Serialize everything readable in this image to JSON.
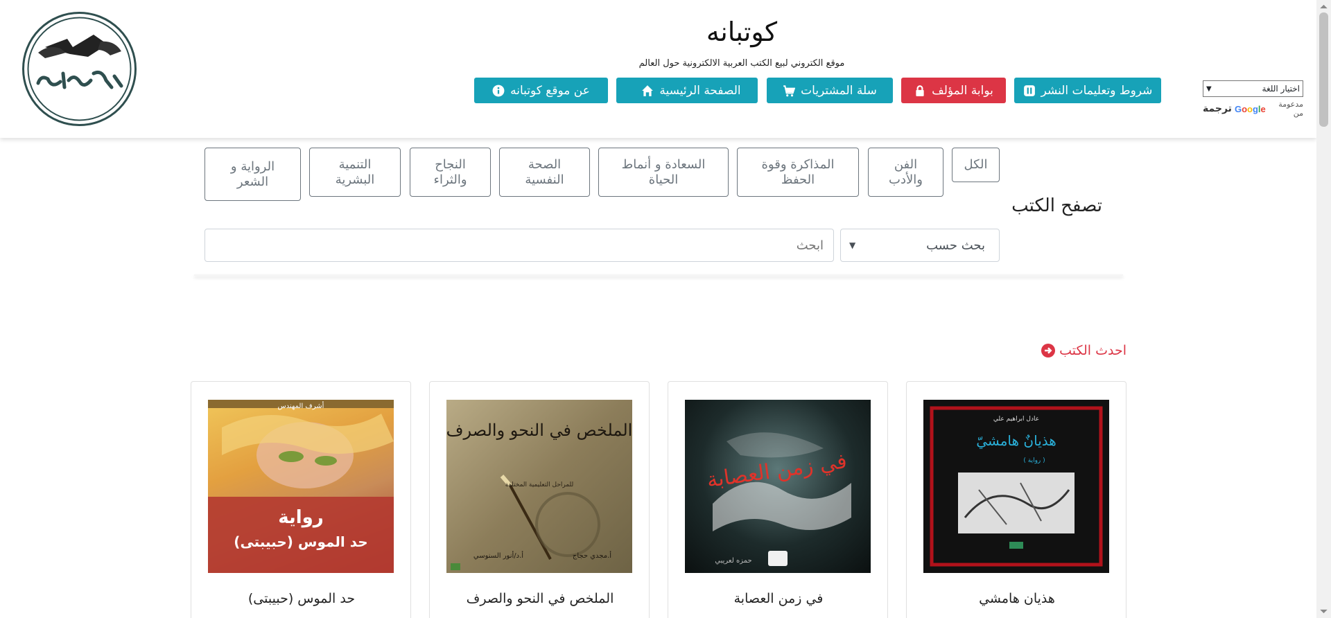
{
  "site": {
    "title": "كوتبانه",
    "subtitle": "موقع الكتروني لبيع الكتب العربية الالكترونية حول العالم"
  },
  "language": {
    "select_label": "اختيار اللغة",
    "powered_by": "مدعومة من",
    "google": "Google",
    "translate": "ترجمة"
  },
  "nav": [
    {
      "label": "شروط وتعليمات النشر",
      "icon": "pause-square-icon",
      "style": "teal"
    },
    {
      "label": "بوابة المؤلف",
      "icon": "lock-icon",
      "style": "red"
    },
    {
      "label": "سلة المشتريات",
      "icon": "cart-icon",
      "style": "teal"
    },
    {
      "label": "الصفحة الرئيسية",
      "icon": "home-icon",
      "style": "teal"
    },
    {
      "label": "عن موقع كوتبانه",
      "icon": "info-icon",
      "style": "teal"
    }
  ],
  "browse": {
    "title": "تصفح الكتب",
    "categories": [
      {
        "line1": "الكل",
        "line2": ""
      },
      {
        "line1": "الفن",
        "line2": "والأدب"
      },
      {
        "line1": "المذاكرة وقوة",
        "line2": "الحفظ"
      },
      {
        "line1": "السعادة و أنماط",
        "line2": "الحياة"
      },
      {
        "line1": "الصحة",
        "line2": "النفسية"
      },
      {
        "line1": "النجاح",
        "line2": "والثراء"
      },
      {
        "line1": "التنمية",
        "line2": "البشرية"
      },
      {
        "line1": "الرواية و",
        "line2": "الشعر"
      }
    ],
    "search_by": "بحث حسب",
    "search_placeholder": "ابحث"
  },
  "latest": {
    "label": "احدث الكتب",
    "books": [
      {
        "title": "هذيان هامشي",
        "cover_text": "هذيانٌ هامشيّ",
        "cover_author": "عادل ابراهيم علي",
        "cover_tag": "( رواية )"
      },
      {
        "title": "في زمن العصابة",
        "cover_text": "في زمن العصابة",
        "cover_author": "حمزه لعريبي"
      },
      {
        "title": "الملخص في النحو والصرف",
        "cover_text": "الملخص في النحو والصرف",
        "cover_sub": "للمراحل التعليمية المختلفة",
        "cover_author": "أ.مجدي حجاج",
        "cover_author2": "أ.د/أنور السنوسي"
      },
      {
        "title": "حد الموس (حبيبتى)",
        "cover_text": "حد الموس (حبيبتى)",
        "cover_tag": "رواية",
        "cover_author": "أشرف المهندس"
      }
    ]
  }
}
